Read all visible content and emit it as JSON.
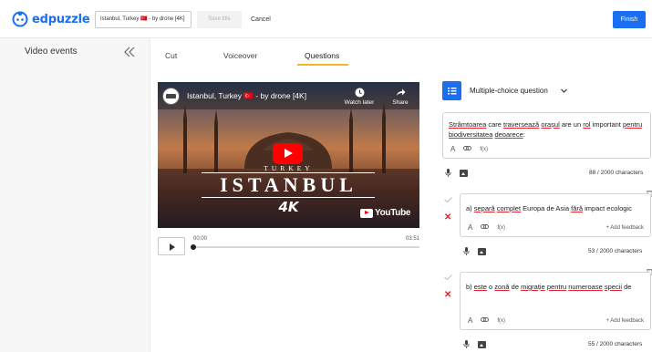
{
  "app": {
    "logo_text": "edpuzzle",
    "title_value": "Istanbul, Turkey 🇹🇷 - by drone [4K]",
    "save_label": "Save title",
    "cancel_label": "Cancel",
    "finish_label": "Finish",
    "brand_color": "#1a6ef0"
  },
  "sidebar": {
    "title": "Video events",
    "collapse_icon": "double-chevron-left-icon"
  },
  "tabs": [
    {
      "label": "Cut",
      "active": false
    },
    {
      "label": "Voiceover",
      "active": false
    },
    {
      "label": "Questions",
      "active": true
    }
  ],
  "video": {
    "title": "Istanbul, Turkey 🇹🇷 - by drone [4K]",
    "watch_later": "Watch later",
    "share": "Share",
    "overlay_small": "TURKEY",
    "overlay_big": "ISTANBUL",
    "overlay_4k": "4K",
    "youtube": "YouTube",
    "time_current": "00:00",
    "time_total": "03:51",
    "progress_fraction": 0.0
  },
  "question": {
    "type_label": "Multiple-choice question",
    "text_words": [
      {
        "t": "Strâmtoarea",
        "u": true
      },
      {
        "t": " care ",
        "u": false
      },
      {
        "t": "traversează",
        "u": true
      },
      {
        "t": " ",
        "u": false
      },
      {
        "t": "orașul",
        "u": true
      },
      {
        "t": " are un ",
        "u": false
      },
      {
        "t": "rol",
        "u": true
      },
      {
        "t": " important ",
        "u": false
      },
      {
        "t": "pentru",
        "u": true
      },
      {
        "t": " ",
        "u": false
      },
      {
        "t": "biodiversitatea",
        "u": true
      },
      {
        "t": " ",
        "u": false
      },
      {
        "t": "deoarece",
        "u": true
      },
      {
        "t": ":",
        "u": false
      }
    ],
    "counter": "88 / 2000 characters",
    "format_bar": [
      "A",
      "∅",
      "f(x)"
    ]
  },
  "answers": [
    {
      "words": [
        {
          "t": "a) ",
          "u": false
        },
        {
          "t": "separă",
          "u": true
        },
        {
          "t": " ",
          "u": false
        },
        {
          "t": "complet",
          "u": true
        },
        {
          "t": " Europa de Asia ",
          "u": false
        },
        {
          "t": "fără",
          "u": true
        },
        {
          "t": " impact ecologic",
          "u": false
        }
      ],
      "add_feedback": "+ Add feedback",
      "counter": "53 / 2000 characters"
    },
    {
      "words": [
        {
          "t": "b) ",
          "u": false
        },
        {
          "t": "este",
          "u": true
        },
        {
          "t": " o ",
          "u": false
        },
        {
          "t": "zonă",
          "u": true
        },
        {
          "t": " de ",
          "u": false
        },
        {
          "t": "migrație",
          "u": true
        },
        {
          "t": " ",
          "u": false
        },
        {
          "t": "pentru",
          "u": true
        },
        {
          "t": " ",
          "u": false
        },
        {
          "t": "numeroase",
          "u": true
        },
        {
          "t": " ",
          "u": false
        },
        {
          "t": "specii",
          "u": true
        },
        {
          "t": " de",
          "u": false
        }
      ],
      "add_feedback": "+ Add feedback",
      "counter": "55 / 2000 characters"
    }
  ]
}
